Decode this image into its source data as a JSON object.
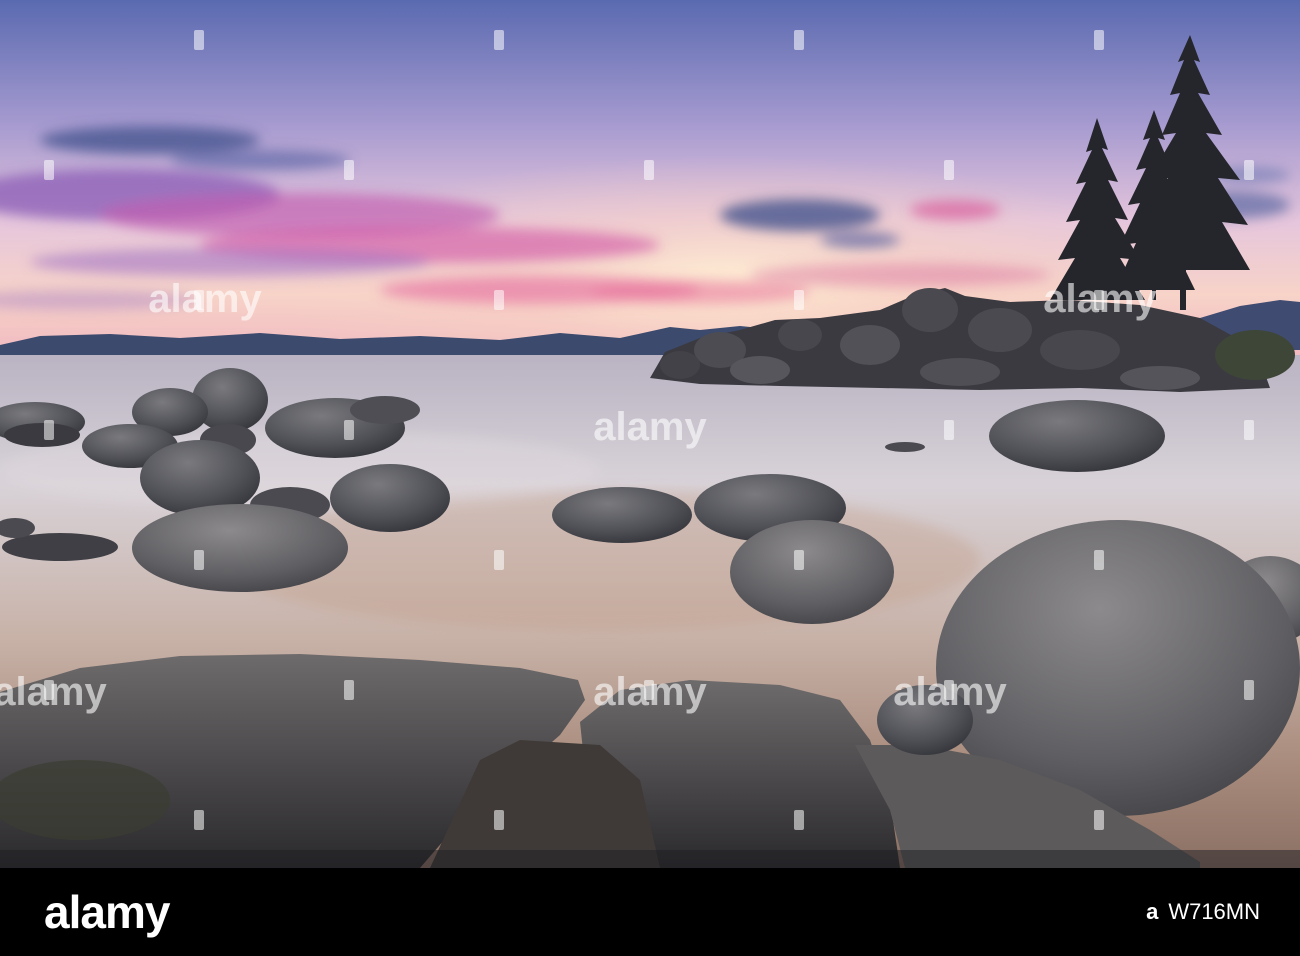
{
  "scene": {
    "subject": "",
    "colors": {
      "sky_top": "#5f6fb4",
      "sky_mid": "#c9a9d6",
      "sky_glow": "#f6c9c4",
      "cloud_magenta": "#d35ea8",
      "cloud_violet": "#8a5bb5",
      "cloud_dark": "#4d5a94",
      "mountains": "#3c4a6e",
      "water_light": "#d7cfd4",
      "water_warm": "#b5968a",
      "rock": "#5a5a5d",
      "rock_dark": "#2e2f35",
      "tree": "#25262c"
    }
  },
  "watermark": {
    "text": "alamy"
  },
  "footer": {
    "brand": "alamy",
    "image_id_prefix": "a",
    "image_id": "W716MN"
  }
}
